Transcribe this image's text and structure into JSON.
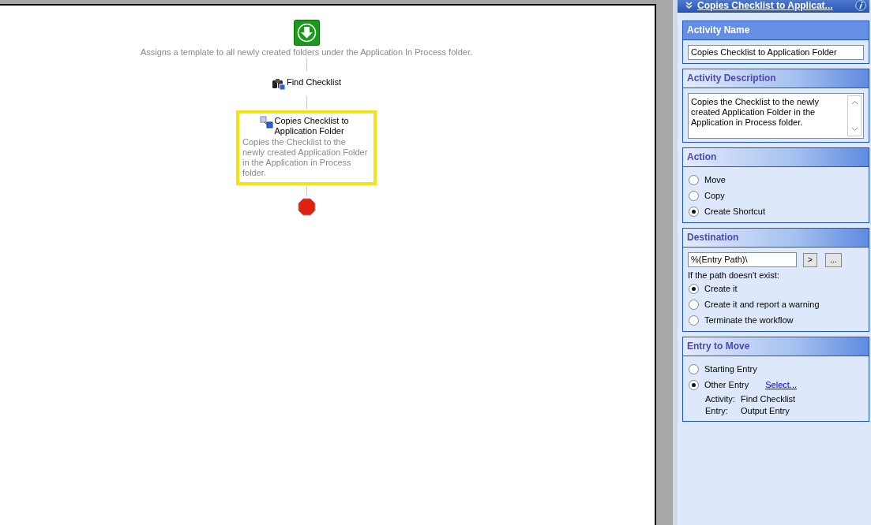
{
  "panel_header": {
    "title": "Copies Checklist to Applicat..."
  },
  "workflow": {
    "steps": [
      {
        "kind": "start",
        "description": "Assigns a template to all newly created folders under the Application In Process folder."
      },
      {
        "kind": "search",
        "title": "Find Checklist",
        "selected": false
      },
      {
        "kind": "shortcut",
        "title": "Copies Checklist to Application Folder",
        "description": "Copies the Checklist to the newly created Application Folder in the Application in Process folder.",
        "selected": true
      },
      {
        "kind": "stop"
      }
    ]
  },
  "sections": [
    {
      "kind": "text",
      "title": "Activity Name",
      "active": true,
      "value": "Copies Checklist to Application Folder"
    },
    {
      "kind": "textarea",
      "title": "Activity Description",
      "active": false,
      "value": "Copies the Checklist to the newly created Application Folder in the Application in Process folder."
    },
    {
      "kind": "radios",
      "title": "Action",
      "active": false,
      "options": [
        {
          "label": "Move",
          "selected": false
        },
        {
          "label": "Copy",
          "selected": false
        },
        {
          "label": "Create Shortcut",
          "selected": true
        }
      ]
    },
    {
      "kind": "destination",
      "title": "Destination",
      "active": false,
      "value": "%(Entry Path)\\",
      "buttons": [
        ">",
        "..."
      ],
      "prompt": "If the path doesn't exist:",
      "options": [
        {
          "label": "Create it",
          "selected": true
        },
        {
          "label": "Create it and report a warning",
          "selected": false
        },
        {
          "label": "Terminate the workflow",
          "selected": false
        }
      ]
    },
    {
      "kind": "entry",
      "title": "Entry to Move",
      "active": false,
      "options": [
        {
          "label": "Starting Entry",
          "selected": false
        },
        {
          "label": "Other Entry",
          "selected": true,
          "link": "Select..."
        }
      ],
      "details": [
        {
          "label": "Activity:",
          "value": "Find Checklist"
        },
        {
          "label": "Entry:",
          "value": "Output Entry"
        }
      ]
    }
  ]
}
